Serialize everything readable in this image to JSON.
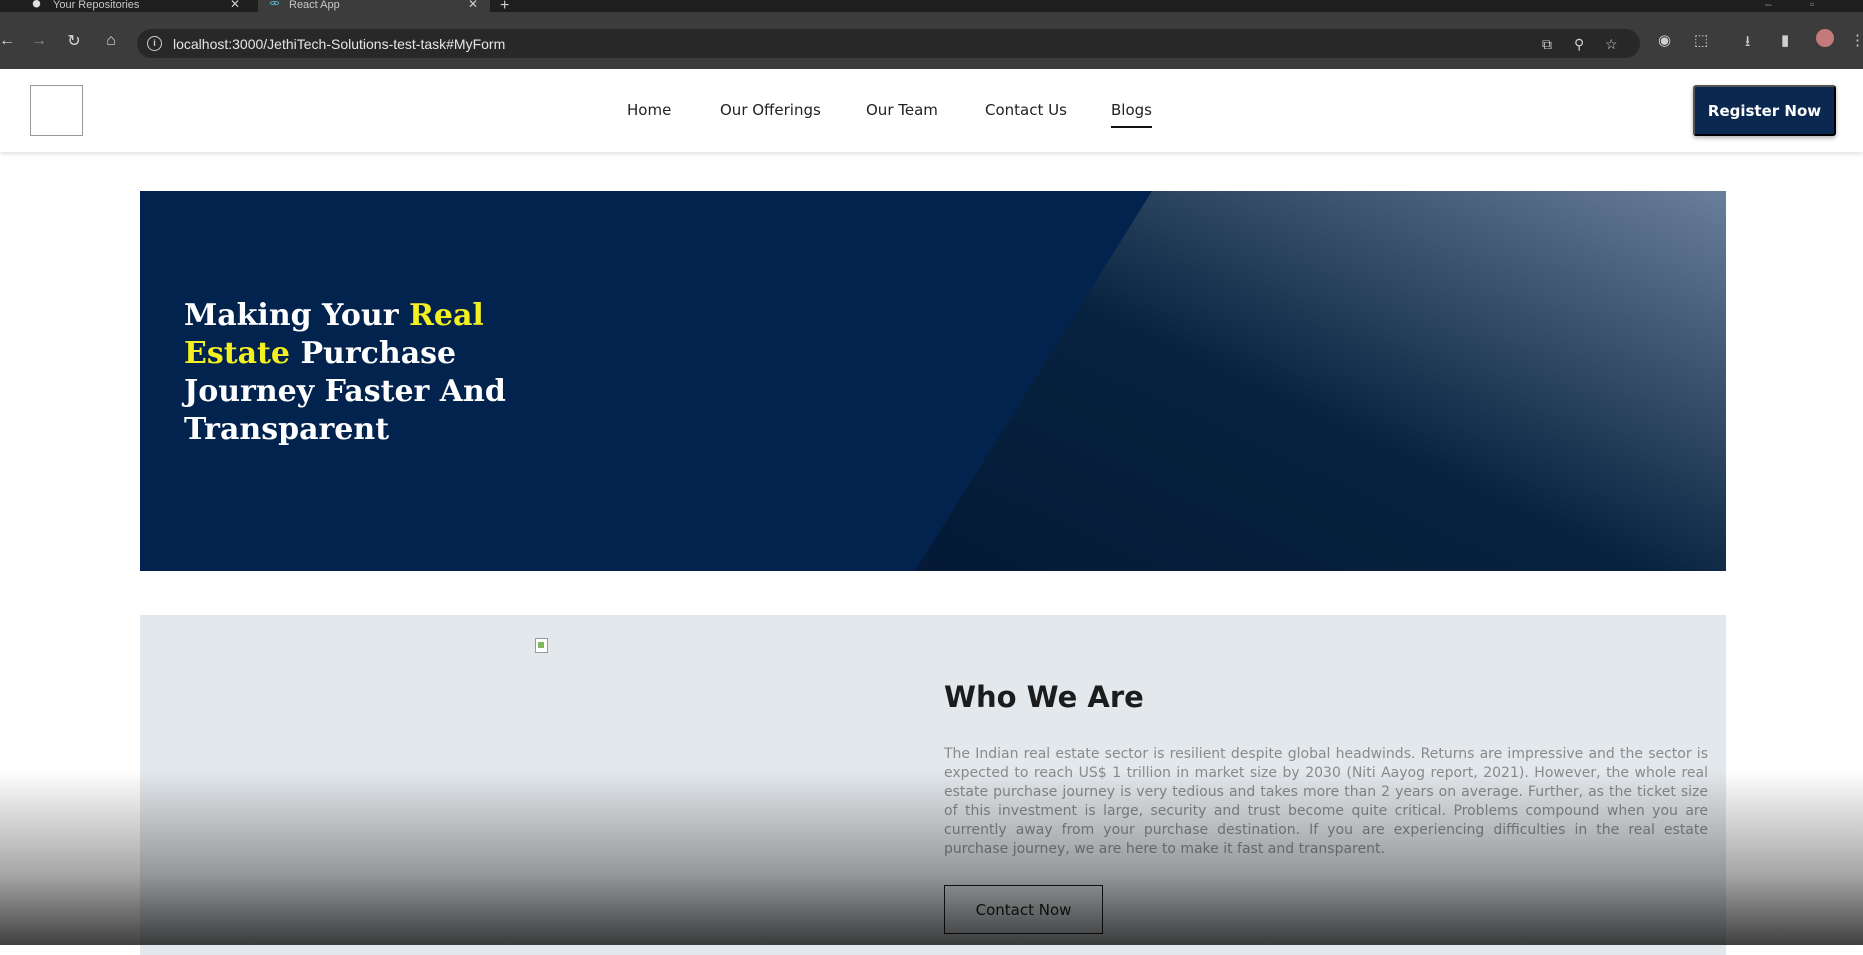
{
  "browser": {
    "tabs": [
      {
        "title": "Your Repositories",
        "icon": "github-icon"
      },
      {
        "title": "React App",
        "icon": "react-icon"
      }
    ],
    "url": "localhost:3000/JethiTech-Solutions-test-task#MyForm"
  },
  "header": {
    "nav": [
      {
        "label": "Home"
      },
      {
        "label": "Our Offerings"
      },
      {
        "label": "Our Team"
      },
      {
        "label": "Contact Us"
      },
      {
        "label": "Blogs",
        "active": true
      }
    ],
    "register_label": "Register Now"
  },
  "hero": {
    "title_part1": "Making Your ",
    "title_highlight": "Real Estate",
    "title_part2": " Purchase Journey Faster And Transparent",
    "highlight_color": "#f4ef21",
    "background_color": "#02234e"
  },
  "who": {
    "title": "Who We Are",
    "body": "The Indian real estate sector is resilient despite global headwinds. Returns are impressive and the sector is expected to reach US$ 1 trillion in market size by 2030 (Niti Aayog report, 2021). However, the whole real estate purchase journey is very tedious and takes more than 2 years on average. Further, as the ticket size of this investment is large, security and trust become quite critical. Problems compound when you are currently away from your purchase destination. If you are experiencing difficulties in the real estate purchase journey, we are here to make it fast and transparent.",
    "button_label": "Contact Now"
  }
}
